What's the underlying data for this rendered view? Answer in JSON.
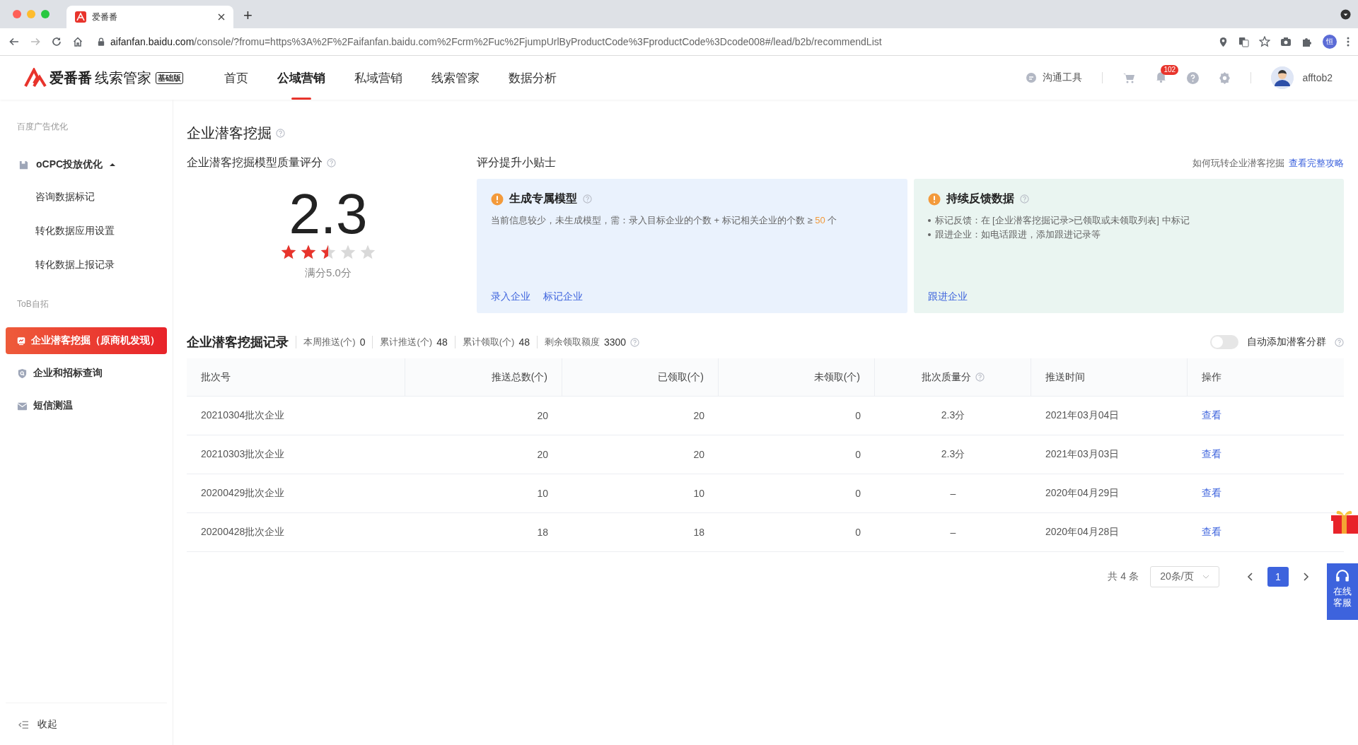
{
  "browser": {
    "tab_title": "爱番番",
    "new_tab": "+",
    "url_host": "aifanfan.baidu.com",
    "url_path": "/console/?fromu=https%3A%2F%2Faifanfan.baidu.com%2Fcrm%2Fuc%2FjumpUrlByProductCode%3FproductCode%3Dcode008#/lead/b2b/recommendList",
    "avatar": "恒"
  },
  "header": {
    "logo": "爱番番",
    "product": "线索管家",
    "edition": "基础版",
    "nav": [
      {
        "label": "首页",
        "selected": false
      },
      {
        "label": "公域营销",
        "selected": true
      },
      {
        "label": "私域营销",
        "selected": false
      },
      {
        "label": "线索管家",
        "selected": false
      },
      {
        "label": "数据分析",
        "selected": false
      }
    ],
    "tool": "沟通工具",
    "badge": "102",
    "user": "afftob2"
  },
  "sidebar": {
    "items": [
      {
        "kind": "heading",
        "label": "百度广告优化"
      },
      {
        "kind": "parent",
        "label": "oCPC投放优化",
        "expanded": true,
        "selected": false
      },
      {
        "kind": "child",
        "label": "咨询数据标记",
        "selected": false
      },
      {
        "kind": "child",
        "label": "转化数据应用设置",
        "selected": false
      },
      {
        "kind": "child",
        "label": "转化数据上报记录",
        "selected": false
      },
      {
        "kind": "heading",
        "label": "ToB自拓"
      },
      {
        "kind": "item",
        "label": "企业潜客挖掘（原商机发现）",
        "selected": true
      },
      {
        "kind": "item",
        "label": "企业和招标查询",
        "selected": false
      },
      {
        "kind": "item",
        "label": "短信测温",
        "selected": false
      }
    ],
    "collapse": "收起"
  },
  "page": {
    "title": "企业潜客挖掘",
    "score": {
      "label": "企业潜客挖掘模型质量评分",
      "value": "2.3",
      "stars": 2.5,
      "max": "满分5.0分"
    },
    "tips": {
      "title": "评分提升小贴士",
      "help_text": "如何玩转企业潜客挖掘",
      "help_link": "查看完整攻略",
      "cards": [
        {
          "kind": "description",
          "title": "生成专属模型",
          "before": "当前信息较少，未生成模型，需：录入目标企业的个数 + 标记相关企业的个数 ≥ ",
          "highlight": "50",
          "after": " 个",
          "links": [
            "录入企业",
            "标记企业"
          ]
        },
        {
          "kind": "bullets",
          "title": "持续反馈数据",
          "bullets": [
            "标记反馈：在 [企业潜客挖掘记录>已领取或未领取列表] 中标记",
            "跟进企业：如电话跟进，添加跟进记录等"
          ],
          "links": [
            "跟进企业"
          ]
        }
      ]
    },
    "records": {
      "title": "企业潜客挖掘记录",
      "stats": [
        {
          "label": "本周推送(个)",
          "value": "0",
          "help": false
        },
        {
          "label": "累计推送(个)",
          "value": "48",
          "help": false
        },
        {
          "label": "累计领取(个)",
          "value": "48",
          "help": false
        },
        {
          "label": "剩余领取额度",
          "value": "3300",
          "help": true
        }
      ],
      "toggle": {
        "label": "自动添加潜客分群",
        "on": false
      },
      "columns": [
        {
          "label": "批次号",
          "help": false
        },
        {
          "label": "推送总数(个)",
          "help": false
        },
        {
          "label": "已领取(个)",
          "help": false
        },
        {
          "label": "未领取(个)",
          "help": false
        },
        {
          "label": "批次质量分",
          "help": true
        },
        {
          "label": "推送时间",
          "help": false
        },
        {
          "label": "操作",
          "help": false
        }
      ],
      "rows": [
        {
          "cells": [
            "20210304批次企业",
            "20",
            "20",
            "0",
            "2.3分",
            "2021年03月04日"
          ],
          "action": "查看"
        },
        {
          "cells": [
            "20210303批次企业",
            "20",
            "20",
            "0",
            "2.3分",
            "2021年03月03日"
          ],
          "action": "查看"
        },
        {
          "cells": [
            "20200429批次企业",
            "10",
            "10",
            "0",
            "–",
            "2020年04月29日"
          ],
          "action": "查看"
        },
        {
          "cells": [
            "20200428批次企业",
            "18",
            "18",
            "0",
            "–",
            "2020年04月28日"
          ],
          "action": "查看"
        }
      ],
      "pagination": {
        "total": "共 4 条",
        "page_size": "20条/页",
        "pages": [
          {
            "label": "1",
            "selected": true
          }
        ]
      }
    }
  },
  "service": {
    "label": "在线客服"
  }
}
